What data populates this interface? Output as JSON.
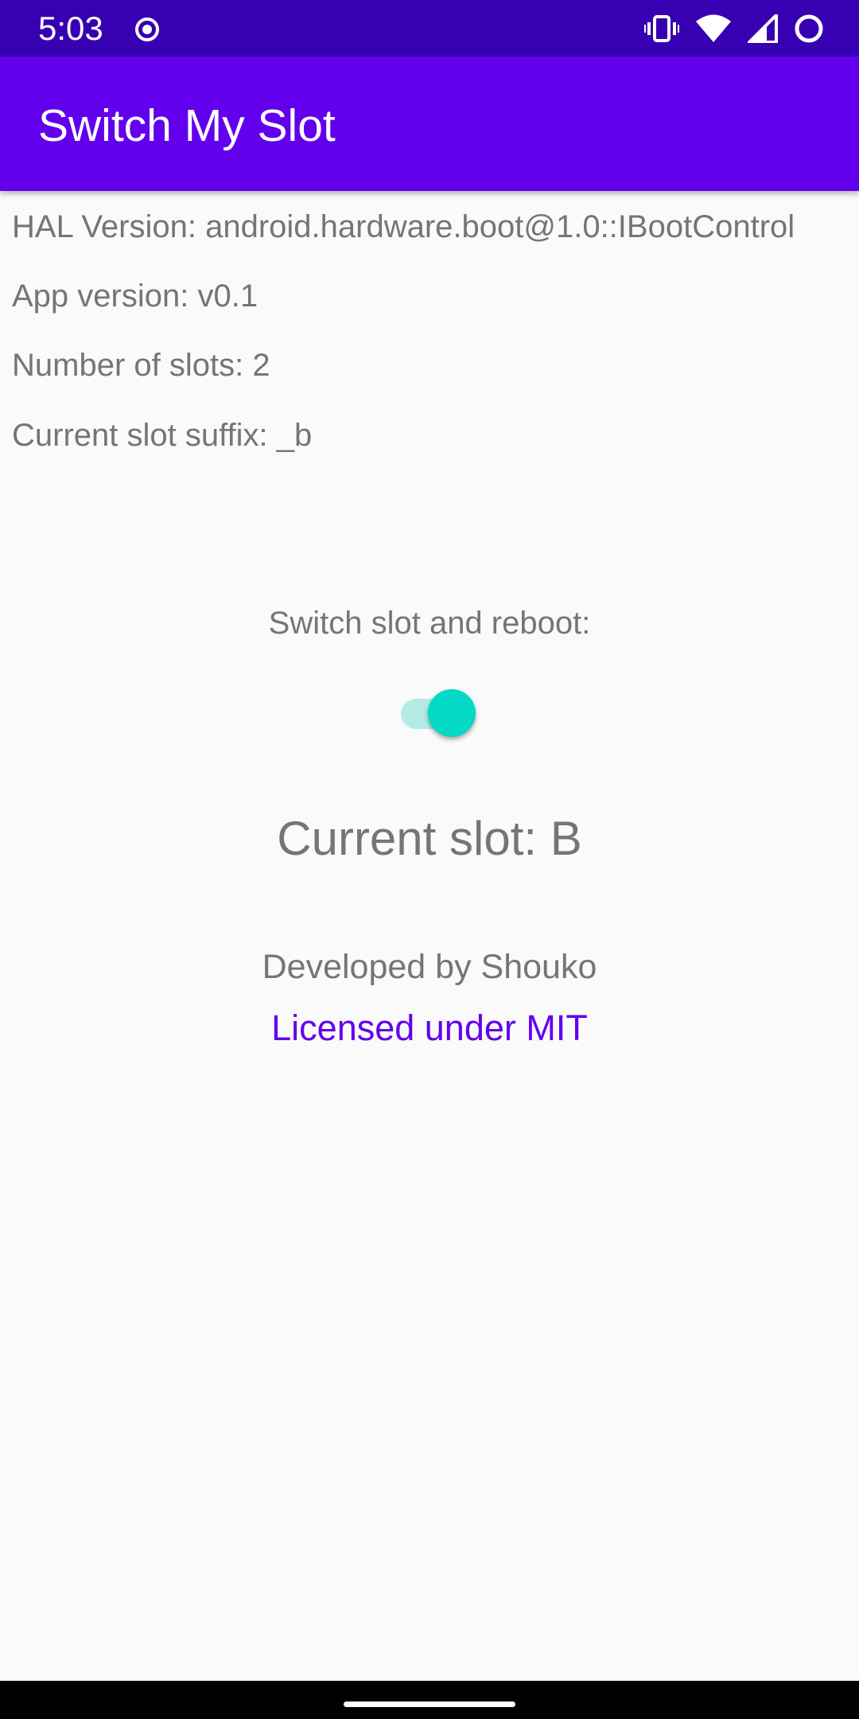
{
  "status_bar": {
    "time": "5:03",
    "left_icon": "record-icon",
    "right_icons": [
      "vibrate-icon",
      "wifi-icon",
      "signal-icon",
      "battery-icon"
    ],
    "background": "#3700b3"
  },
  "app_bar": {
    "title": "Switch My Slot",
    "background": "#6200ee"
  },
  "info": {
    "hal_version": "HAL Version: android.hardware.boot@1.0::IBootControl",
    "app_version": "App version: v0.1",
    "slot_count": "Number of slots: 2",
    "slot_suffix": "Current slot suffix: _b"
  },
  "switch_section": {
    "label": "Switch slot and reboot:",
    "toggle_on": true,
    "accent": "#03dac5"
  },
  "current_slot": "Current slot: B",
  "footer": {
    "developer": "Developed by Shouko",
    "license": "Licensed under MIT",
    "license_color": "#6200ee"
  }
}
